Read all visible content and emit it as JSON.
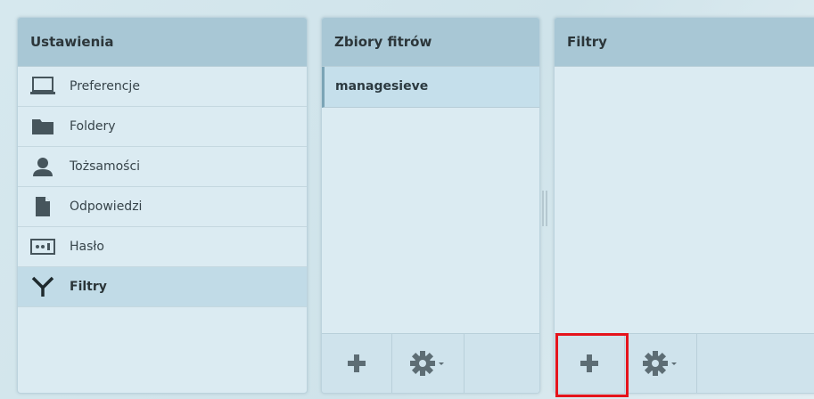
{
  "settings": {
    "title": "Ustawienia",
    "items": [
      {
        "label": "Preferencje",
        "icon": "laptop-icon"
      },
      {
        "label": "Foldery",
        "icon": "folder-icon"
      },
      {
        "label": "Tożsamości",
        "icon": "user-icon"
      },
      {
        "label": "Odpowiedzi",
        "icon": "document-icon"
      },
      {
        "label": "Hasło",
        "icon": "password-icon"
      },
      {
        "label": "Filtry",
        "icon": "filter-icon",
        "selected": true
      }
    ]
  },
  "filter_sets": {
    "title": "Zbiory fitrów",
    "items": [
      {
        "label": "managesieve",
        "selected": true
      }
    ]
  },
  "filters": {
    "title": "Filtry"
  },
  "colors": {
    "header_bg": "#a8c7d5",
    "panel_bg": "#dbebf2",
    "selected_bg": "#c1dbe7",
    "highlight": "#e5141c"
  }
}
